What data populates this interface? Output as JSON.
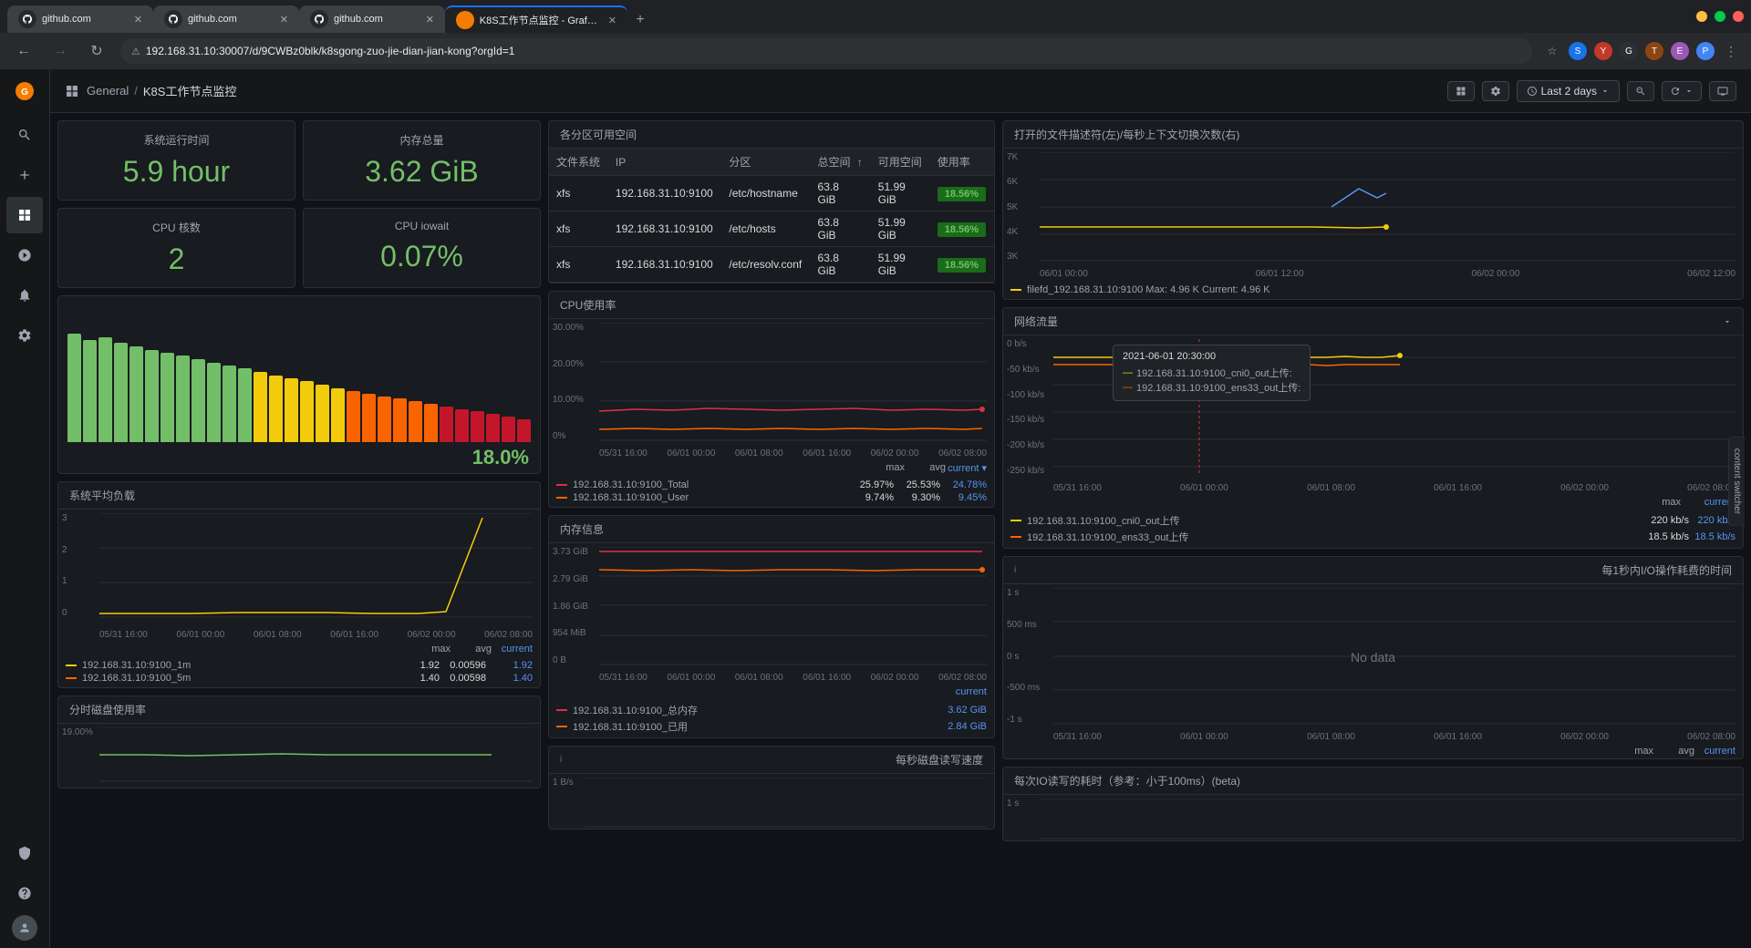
{
  "browser": {
    "tabs": [
      {
        "label": "github.com",
        "favicon": "github",
        "active": false
      },
      {
        "label": "github.com",
        "favicon": "github",
        "active": false
      },
      {
        "label": "github.com",
        "favicon": "github",
        "active": false
      },
      {
        "label": "K8S工作节点监控 - Grafana",
        "favicon": "grafana",
        "active": true
      }
    ],
    "url": "192.168.31.10:30007/d/9CWBz0blk/k8sgong-zuo-jie-dian-jian-kong?orgId=1"
  },
  "header": {
    "breadcrumb": {
      "general": "General",
      "separator": "/",
      "current": "K8S工作节点监控"
    },
    "timerange": "Last 2 days"
  },
  "stats": {
    "uptime_label": "系统运行时间",
    "uptime_value": "5.9 hour",
    "memory_label": "内存总量",
    "memory_value": "3.62 GiB",
    "cpu_cores_label": "CPU 核数",
    "cpu_cores_value": "2",
    "cpu_iowait_label": "CPU iowait",
    "cpu_iowait_value": "0.07%"
  },
  "cpu_gauge": {
    "value": "18.0%",
    "bars": [
      85,
      80,
      82,
      78,
      75,
      72,
      70,
      68,
      65,
      62,
      60,
      58,
      55,
      52,
      50,
      48,
      45,
      42,
      40,
      38,
      36,
      34,
      32,
      30,
      28,
      26,
      24,
      22,
      20,
      18
    ]
  },
  "disk_partitions": {
    "title": "各分区可用空间",
    "headers": [
      "文件系统",
      "IP",
      "分区",
      "总空间",
      "可用空间",
      "使用率"
    ],
    "rows": [
      {
        "fs": "xfs",
        "ip": "192.168.31.10:9100",
        "partition": "/etc/hostname",
        "total": "63.8 GiB",
        "available": "51.99 GiB",
        "usage": "18.56%"
      },
      {
        "fs": "xfs",
        "ip": "192.168.31.10:9100",
        "partition": "/etc/hosts",
        "total": "63.8 GiB",
        "available": "51.99 GiB",
        "usage": "18.56%"
      },
      {
        "fs": "xfs",
        "ip": "192.168.31.10:9100",
        "partition": "/etc/resolv.conf",
        "total": "63.8 GiB",
        "available": "51.99 GiB",
        "usage": "18.56%"
      }
    ]
  },
  "load_chart": {
    "title": "系统平均负载",
    "y_labels": [
      "3",
      "2",
      "1",
      "0"
    ],
    "x_labels": [
      "05/31 16:00",
      "06/01 00:00",
      "06/01 08:00",
      "06/01 16:00",
      "06/02 00:00",
      "06/02 08:00"
    ],
    "legend": [
      {
        "color": "#f2cc0c",
        "label": "192.168.31.10:9100_1m",
        "max": "1.92",
        "avg": "0.00596",
        "current": "1.92"
      },
      {
        "color": "#fa6400",
        "label": "192.168.31.10:9100_5m",
        "max": "1.40",
        "avg": "0.00598",
        "current": "1.40"
      }
    ]
  },
  "disk_usage_chart": {
    "title": "分时磁盘使用率",
    "y_start": "19.00%"
  },
  "cpu_usage_chart": {
    "title": "CPU使用率",
    "y_labels": [
      "30.00%",
      "20.00%",
      "10.00%",
      "0%"
    ],
    "x_labels": [
      "05/31 16:00",
      "06/01 00:00",
      "06/01 08:00",
      "06/01 16:00",
      "06/02 00:00",
      "06/02 08:00"
    ],
    "legend": [
      {
        "color": "#e02f44",
        "label": "192.168.31.10:9100_Total",
        "max": "25.97%",
        "avg": "25.53%",
        "current": "24.78%"
      },
      {
        "color": "#fa6400",
        "label": "192.168.31.10:9100_User",
        "max": "9.74%",
        "avg": "9.30%",
        "current": "9.45%"
      }
    ]
  },
  "memory_chart": {
    "title": "内存信息",
    "y_labels": [
      "3.73 GiB",
      "2.79 GiB",
      "1.86 GiB",
      "954 MiB",
      "0 B"
    ],
    "x_labels": [
      "05/31 16:00",
      "06/01 00:00",
      "06/01 08:00",
      "06/01 16:00",
      "06/02 00:00",
      "06/02 08:00"
    ],
    "legend": [
      {
        "color": "#e02f44",
        "label": "192.168.31.10:9100_总内存",
        "max": "",
        "avg": "",
        "current": "3.62 GiB"
      },
      {
        "color": "#fa6400",
        "label": "192.168.31.10:9100_已用",
        "max": "",
        "avg": "",
        "current": "2.84 GiB"
      }
    ]
  },
  "disk_rw_chart": {
    "title": "每秒磁盘读写速度",
    "y_start": "1 B/s"
  },
  "files_chart": {
    "title": "打开的文件描述符(左)/每秒上下文切换次数(右)",
    "y_labels": [
      "7K",
      "6K",
      "5K",
      "4K",
      "3K"
    ],
    "x_labels": [
      "06/01 00:00",
      "06/01 12:00",
      "06/02 00:00",
      "06/02 12:00"
    ],
    "legend_text": "filefd_192.168.31.10:9100 Max: 4.96 K Current: 4.96 K"
  },
  "network_chart": {
    "title": "网络流量",
    "y_labels": [
      "0 b/s",
      "-50 kb/s",
      "-100 kb/s",
      "-150 kb/s",
      "-200 kb/s",
      "-250 kb/s"
    ],
    "x_labels": [
      "05/31 16:00",
      "06/01 00:00",
      "06/01 08:00",
      "06/01 16:00",
      "06/02 00:00",
      "06/02 08:00"
    ],
    "tooltip": {
      "time": "2021-06-01 20:30:00",
      "line1": "192.168.31.10:9100_cni0_out上传:",
      "line2": "192.168.31.10:9100_ens33_out上传:"
    },
    "legend": [
      {
        "color": "#f2cc0c",
        "label": "192.168.31.10:9100_cni0_out上传",
        "max": "220 kb/s",
        "current": "220 kb/s"
      },
      {
        "color": "#fa6400",
        "label": "192.168.31.10:9100_ens33_out上传",
        "max": "18.5 kb/s",
        "current": "18.5 kb/s"
      }
    ]
  },
  "io_time_chart": {
    "title": "每1秒内I/O操作耗费的时间",
    "y_labels": [
      "1 s",
      "500 ms",
      "0 s",
      "-500 ms",
      "-1 s"
    ],
    "x_labels": [
      "05/31 16:00",
      "06/01 00:00",
      "06/01 08:00",
      "06/01 16:00",
      "06/02 00:00",
      "06/02 08:00"
    ],
    "no_data": "No data"
  },
  "io_read_chart": {
    "title": "每次IO读写的耗时（参考：小于100ms）(beta)",
    "y_start": "1 s"
  },
  "sidebar": {
    "items": [
      {
        "icon": "search",
        "label": "Search"
      },
      {
        "icon": "plus",
        "label": "Create"
      },
      {
        "icon": "grid",
        "label": "Dashboards"
      },
      {
        "icon": "compass",
        "label": "Explore"
      },
      {
        "icon": "bell",
        "label": "Alerting"
      },
      {
        "icon": "gear",
        "label": "Configuration"
      },
      {
        "icon": "shield",
        "label": "Server Admin"
      }
    ]
  }
}
